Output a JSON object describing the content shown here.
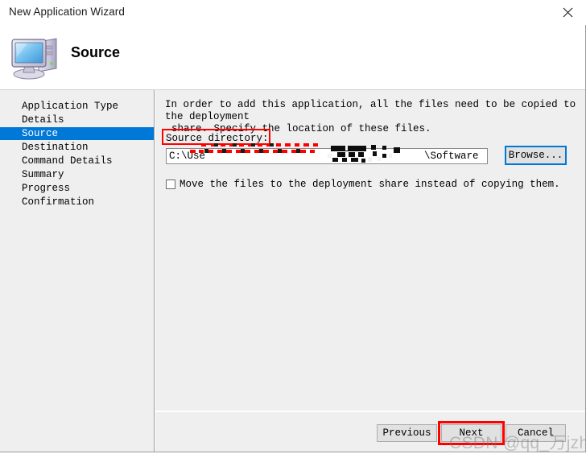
{
  "window": {
    "title": "New Application Wizard",
    "close_icon": "close-icon"
  },
  "header": {
    "title": "Source",
    "icon": "computer-icon"
  },
  "sidebar": {
    "items": [
      {
        "label": "Application Type",
        "selected": false
      },
      {
        "label": "Details",
        "selected": false
      },
      {
        "label": "Source",
        "selected": true
      },
      {
        "label": "Destination",
        "selected": false
      },
      {
        "label": "Command Details",
        "selected": false
      },
      {
        "label": "Summary",
        "selected": false
      },
      {
        "label": "Progress",
        "selected": false
      },
      {
        "label": "Confirmation",
        "selected": false
      }
    ]
  },
  "main": {
    "instructions_line1": "In order to add this application, all the files need to be copied to the deployment",
    "instructions_line2": "share.  Specify the location of these files.",
    "source_directory_label": "Source directory:",
    "source_directory_value_prefix": "C:\\Use",
    "source_directory_value_suffix": "\\Software",
    "source_directory_placeholder": "",
    "browse_label": "Browse...",
    "move_files_label": "Move the files to the deployment share instead of copying them.",
    "move_files_checked": false
  },
  "footer": {
    "previous_label": "Previous",
    "next_label": "Next",
    "cancel_label": "Cancel"
  },
  "watermark": {
    "text": "CSDN @qq_万jzhang"
  },
  "colors": {
    "accent": "#0078d7",
    "annotation": "#ff0000",
    "panel": "#efefef",
    "button_face": "#e1e1e1"
  }
}
